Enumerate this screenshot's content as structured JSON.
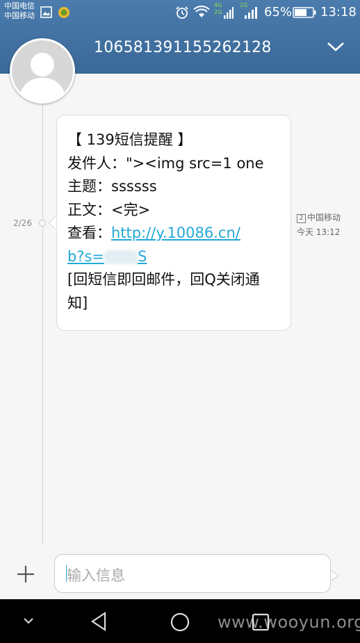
{
  "status_bar": {
    "carrier_1": "中国电信",
    "carrier_2": "中国移动",
    "network_1": "4G",
    "network_2": "2G",
    "network_3": "2G",
    "battery": "65%",
    "time": "13:18"
  },
  "header": {
    "sender_number": "106581391155262128"
  },
  "conversation": {
    "counter": "2/26",
    "message": {
      "title_line": "【 139短信提醒 】",
      "sender_line": "发件人：\"><img src=1 one",
      "subject_line": "主题：ssssss",
      "body_line": "正文：<完>",
      "view_label": "查看：",
      "link_part1": "http://y.10086.cn/",
      "link_part2_prefix": "b?s=",
      "link_part2_suffix": "S",
      "reply_line1": "[回短信即回邮件，回Q关闭通",
      "reply_line2": "知]"
    },
    "meta": {
      "sim_slot": "2",
      "carrier": "中国移动",
      "time": "今天 13:12"
    }
  },
  "composer": {
    "placeholder": "输入信息"
  },
  "watermark": "www.wooyun.org",
  "colors": {
    "header": "#3f6f9e",
    "link": "#23a8d8",
    "background": "#f6f6f6"
  }
}
